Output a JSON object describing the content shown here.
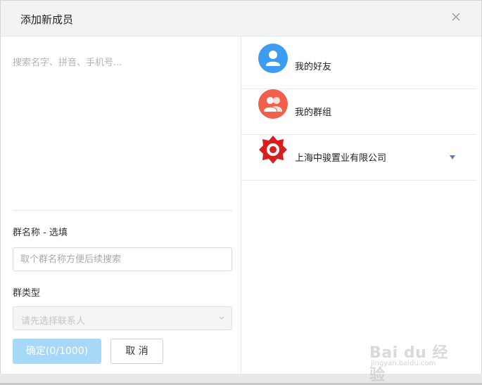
{
  "dialog": {
    "title": "添加新成员",
    "close_icon": "close-icon"
  },
  "left": {
    "search_placeholder": "搜索名字、拼音、手机号...",
    "group_name_label": "群名称 - 选填",
    "group_name_placeholder": "取个群名称方便后续搜索",
    "group_type_label": "群类型",
    "group_type_value": "请先选择联系人",
    "confirm_label": "确定(0/1000)",
    "cancel_label": "取 消"
  },
  "right": {
    "items": [
      {
        "label": "我的好友",
        "icon": "person-icon",
        "color": "#3b9cf2"
      },
      {
        "label": "我的群组",
        "icon": "group-icon",
        "color": "#f0604a"
      },
      {
        "label": "上海中骏置业有限公司",
        "icon": "company-logo",
        "color": "#d81e1e"
      }
    ]
  },
  "colors": {
    "confirm_bg": "#a8d8f8",
    "header_bg": "#f1f3f4"
  },
  "watermark": {
    "text1": "Bai du 经验",
    "text2": "jingyan.baidu.com"
  }
}
